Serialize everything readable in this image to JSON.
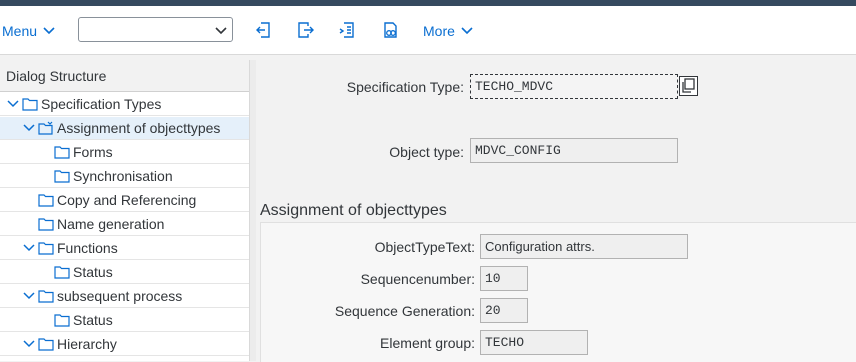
{
  "toolbar": {
    "menu_label": "Menu",
    "combo_value": "",
    "more_label": "More"
  },
  "dialog_structure": {
    "title": "Dialog Structure",
    "items": [
      {
        "label": "Specification Types"
      },
      {
        "label": "Assignment of objecttypes"
      },
      {
        "label": "Forms"
      },
      {
        "label": "Synchronisation"
      },
      {
        "label": "Copy and Referencing"
      },
      {
        "label": "Name generation"
      },
      {
        "label": "Functions"
      },
      {
        "label": "Status"
      },
      {
        "label": "subsequent process"
      },
      {
        "label": "Status"
      },
      {
        "label": "Hierarchy"
      }
    ]
  },
  "header_fields": {
    "spec_type_label": "Specification Type:",
    "spec_type_value": "TECHO_MDVC",
    "object_type_label": "Object type:",
    "object_type_value": "MDVC_CONFIG"
  },
  "section": {
    "title": "Assignment of objecttypes",
    "objecttypetext_label": "ObjectTypeText:",
    "objecttypetext_value": "Configuration attrs.",
    "sequencenumber_label": "Sequencenumber:",
    "sequencenumber_value": "10",
    "sequence_generation_label": "Sequence Generation:",
    "sequence_generation_value": "20",
    "element_group_label": "Element group:",
    "element_group_value": "TECHO"
  },
  "colors": {
    "shell": "#354a5f",
    "link": "#0a6ed1",
    "selected_row": "#e5f0fa"
  }
}
